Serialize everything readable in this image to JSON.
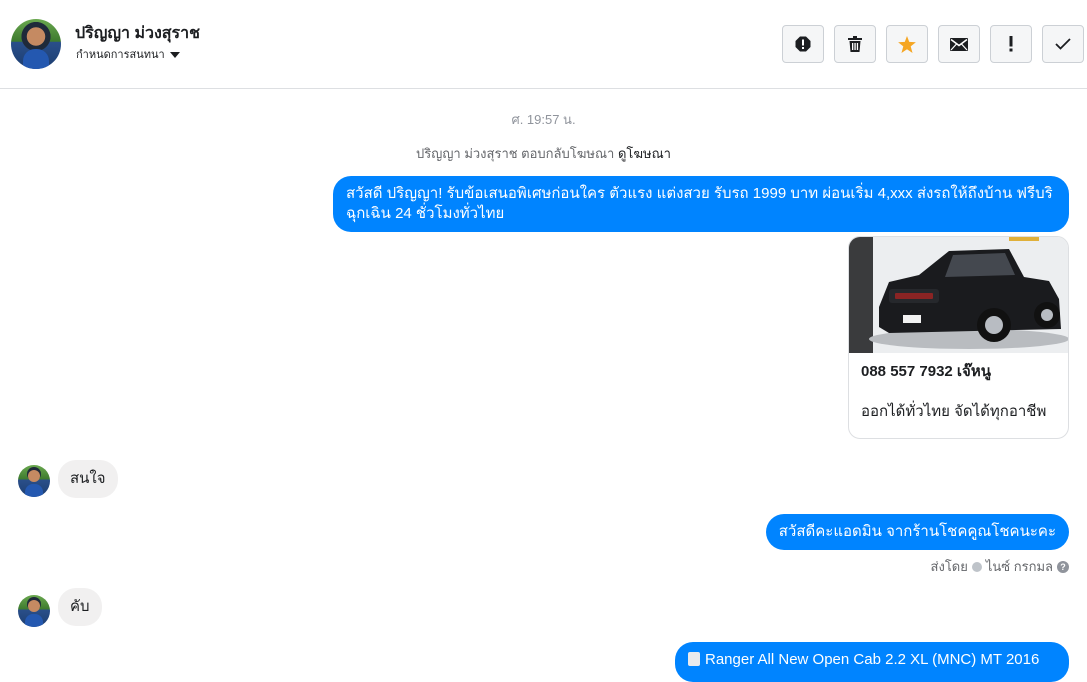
{
  "header": {
    "contact_name": "ปริญญา ม่วงสุราช",
    "subtitle": "กำหนดการสนทนา",
    "toolbar_icons": [
      "report-icon",
      "trash-icon",
      "star-icon",
      "envelope-icon",
      "exclamation-icon",
      "check-icon"
    ],
    "star_color": "#f5a623"
  },
  "thread": {
    "timestamp": "ศ. 19:57 น.",
    "ad_note": "ปริญญา ม่วงสุราช ตอบกลับโฆษณา",
    "ad_link": "ดูโฆษณา",
    "messages": [
      {
        "from": "page",
        "text": "สวัสดี ปริญญา! รับข้อเสนอพิเศษก่อนใคร ตัวแรง แต่งสวย รับรถ 1999 บาท ผ่อนเริ่ม 4,xxx ส่งรถให้ถึงบ้าน ฟรีบริ ฉุกเฉิน 24 ชั่วโมงทั่วไทย"
      },
      {
        "from": "page",
        "type": "card",
        "title": "088 557 7932 เจ๊หนู",
        "description": "ออกได้ทั่วไทย จัดได้ทุกอาชีพ"
      },
      {
        "from": "user",
        "text": "สนใจ"
      },
      {
        "from": "page",
        "text": "สวัสดีคะแอดมิน จากร้านโชคคูณโชคนะคะ"
      },
      {
        "from": "user",
        "text": "คับ"
      },
      {
        "from": "page",
        "text": "Ranger All New Open Cab 2.2 XL (MNC) MT 2016"
      }
    ],
    "sent_by_label": "ส่งโดย",
    "sent_by_name": "ไนซ์ กรกมล",
    "bubble_color": "#0084ff"
  }
}
